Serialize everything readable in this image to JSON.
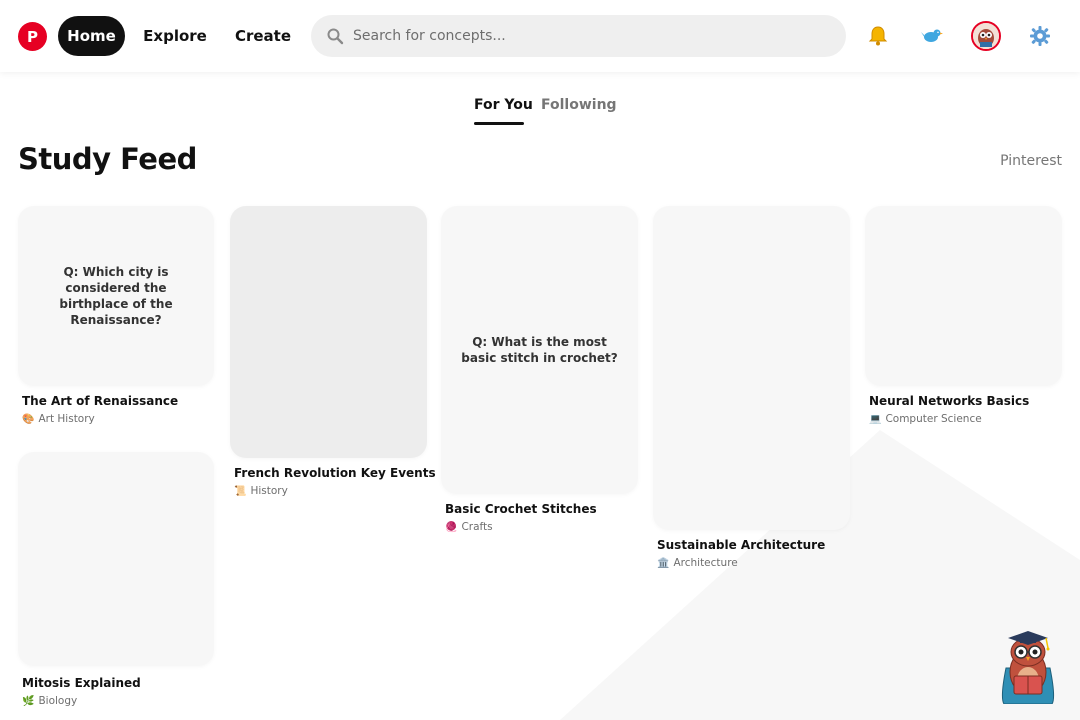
{
  "header": {
    "logo_letter": "P",
    "nav": {
      "home": "Home",
      "explore": "Explore",
      "create": "Create"
    },
    "search": {
      "placeholder": "Search for concepts...",
      "value": ""
    }
  },
  "tabs": [
    {
      "label": "For You",
      "active": true
    },
    {
      "label": "Following",
      "active": false
    }
  ],
  "page_title": "Study Feed",
  "brand_link": "Pinterest",
  "cards": [
    {
      "title": "The Art of Renaissance",
      "question": "Q: Which city is considered the birthplace of the Renaissance?",
      "category": "Art History",
      "category_emoji": "🎨"
    },
    {
      "title": "Mitosis Explained",
      "question": "",
      "category": "Biology",
      "category_emoji": "🌿"
    },
    {
      "title": "French Revolution Key Events",
      "question": "",
      "category": "History",
      "category_emoji": "📜"
    },
    {
      "title": "Basic Crochet Stitches",
      "question": "Q: What is the most basic stitch in crochet?",
      "category": "Crafts",
      "category_emoji": "🧶"
    },
    {
      "title": "Sustainable Architecture",
      "question": "",
      "category": "Architecture",
      "category_emoji": "🏛️"
    },
    {
      "title": "Neural Networks Basics",
      "question": "",
      "category": "Computer Science",
      "category_emoji": "💻"
    }
  ],
  "colors": {
    "brand": "#e60023",
    "active_nav": "#111111",
    "card_bg": "#f7f7f7",
    "muted_text": "#767676"
  },
  "icons": [
    "notification-bell-icon",
    "bird-icon",
    "settings-gear-icon",
    "search-icon"
  ]
}
